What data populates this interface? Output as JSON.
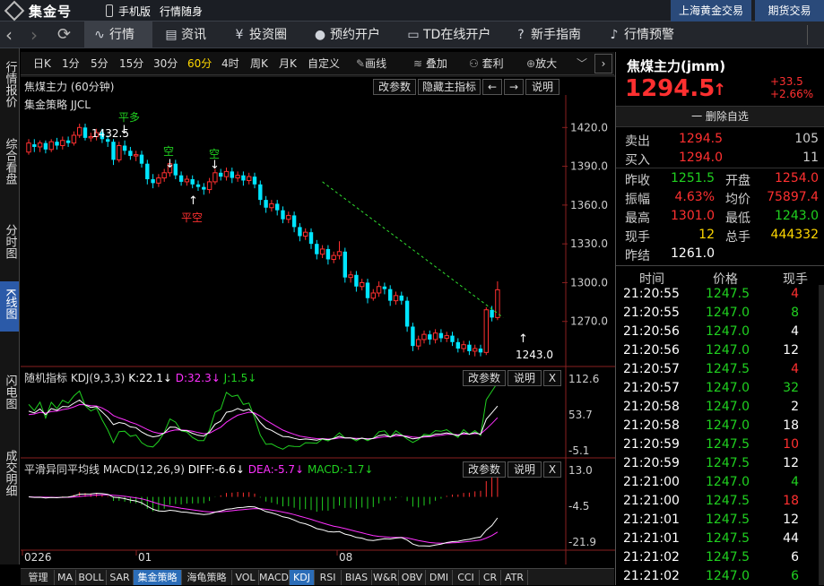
{
  "app": {
    "logo": "集金号",
    "mobile_label": "手机版",
    "mobile_sub": "行情随身",
    "top_links": [
      "上海黄金交易",
      "期货交易"
    ]
  },
  "nav": {
    "items": [
      {
        "label": "行情",
        "icon": "chart-line-icon"
      },
      {
        "label": "资讯",
        "icon": "news-icon"
      },
      {
        "label": "投资圈",
        "icon": "yen-icon"
      },
      {
        "label": "预约开户",
        "icon": "pin-icon"
      },
      {
        "label": "TD在线开户",
        "icon": "card-icon"
      },
      {
        "label": "新手指南",
        "icon": "question-icon"
      },
      {
        "label": "行情预警",
        "icon": "bell-icon"
      }
    ]
  },
  "side_tabs": [
    "行情报价",
    "综合看盘",
    "分时图",
    "K线图",
    "闪电图",
    "成交明细"
  ],
  "periods": [
    "日K",
    "1分",
    "5分",
    "15分",
    "30分",
    "60分",
    "4时",
    "周K",
    "月K",
    "自定义"
  ],
  "tools": [
    "画线",
    "叠加",
    "套利",
    "放大"
  ],
  "main_panel": {
    "title": "焦煤主力 (60分钟)",
    "strategy": "集金策略 JJCL",
    "btn_modify": "改参数",
    "btn_hide": "隐藏主指标",
    "btn_help": "说明",
    "arrow_left": "←",
    "arrow_right": "→"
  },
  "kdj_panel": {
    "title": "随机指标 KDJ(9,3,3)",
    "k": "K:22.1↓",
    "d": "D:32.3↓",
    "j": "J:1.5↓",
    "btn_modify": "改参数",
    "btn_help": "说明",
    "btn_close": "X",
    "ticks": [
      "112.6",
      "53.7",
      "-5.1"
    ]
  },
  "macd_panel": {
    "title": "平滑异同平均线 MACD(12,26,9)",
    "diff": "DIFF:-6.6↓",
    "dea": "DEA:-5.7↓",
    "macd": "MACD:-1.7↓",
    "btn_modify": "改参数",
    "btn_help": "说明",
    "btn_close": "X",
    "ticks": [
      "13.0",
      "-4.5",
      "-21.9"
    ]
  },
  "x_labels": [
    "0226",
    "01",
    "08"
  ],
  "chart_data": {
    "type": "candlestick",
    "y_range": [
      1240,
      1432
    ],
    "y_ticks": [
      1420,
      1390,
      1360,
      1330,
      1300,
      1270
    ],
    "candles": [
      [
        1401,
        1408,
        1399,
        1411
      ],
      [
        1407,
        1405,
        1401,
        1411
      ],
      [
        1405,
        1408,
        1401,
        1410
      ],
      [
        1408,
        1403,
        1400,
        1410
      ],
      [
        1403,
        1409,
        1401,
        1411
      ],
      [
        1409,
        1406,
        1403,
        1412
      ],
      [
        1406,
        1410,
        1403,
        1413
      ],
      [
        1410,
        1408,
        1405,
        1413
      ],
      [
        1408,
        1414,
        1406,
        1417
      ],
      [
        1414,
        1420,
        1412,
        1423
      ],
      [
        1420,
        1412,
        1410,
        1423
      ],
      [
        1412,
        1413,
        1409,
        1416
      ],
      [
        1413,
        1416,
        1410,
        1419
      ],
      [
        1416,
        1411,
        1408,
        1419
      ],
      [
        1411,
        1409,
        1405,
        1414
      ],
      [
        1409,
        1395,
        1391,
        1411
      ],
      [
        1395,
        1406,
        1393,
        1409
      ],
      [
        1406,
        1402,
        1399,
        1410
      ],
      [
        1402,
        1398,
        1395,
        1405
      ],
      [
        1398,
        1399,
        1394,
        1402
      ],
      [
        1399,
        1392,
        1389,
        1402
      ],
      [
        1392,
        1380,
        1376,
        1395
      ],
      [
        1380,
        1377,
        1373,
        1384
      ],
      [
        1377,
        1381,
        1374,
        1384
      ],
      [
        1381,
        1385,
        1378,
        1388
      ],
      [
        1385,
        1392,
        1382,
        1395
      ],
      [
        1392,
        1383,
        1380,
        1395
      ],
      [
        1383,
        1378,
        1375,
        1386
      ],
      [
        1378,
        1380,
        1375,
        1383
      ],
      [
        1380,
        1376,
        1373,
        1383
      ],
      [
        1376,
        1374,
        1371,
        1379
      ],
      [
        1374,
        1372,
        1368,
        1377
      ],
      [
        1372,
        1378,
        1369,
        1381
      ],
      [
        1378,
        1385,
        1376,
        1388
      ],
      [
        1385,
        1382,
        1379,
        1388
      ],
      [
        1382,
        1386,
        1379,
        1389
      ],
      [
        1386,
        1381,
        1377,
        1389
      ],
      [
        1381,
        1383,
        1378,
        1386
      ],
      [
        1383,
        1379,
        1375,
        1386
      ],
      [
        1379,
        1382,
        1376,
        1385
      ],
      [
        1382,
        1376,
        1373,
        1385
      ],
      [
        1376,
        1364,
        1360,
        1379
      ],
      [
        1364,
        1358,
        1354,
        1367
      ],
      [
        1358,
        1361,
        1355,
        1364
      ],
      [
        1361,
        1356,
        1352,
        1364
      ],
      [
        1356,
        1349,
        1346,
        1359
      ],
      [
        1349,
        1352,
        1346,
        1355
      ],
      [
        1352,
        1343,
        1339,
        1355
      ],
      [
        1343,
        1336,
        1332,
        1346
      ],
      [
        1336,
        1339,
        1333,
        1342
      ],
      [
        1339,
        1330,
        1326,
        1342
      ],
      [
        1330,
        1322,
        1318,
        1333
      ],
      [
        1322,
        1326,
        1319,
        1329
      ],
      [
        1326,
        1318,
        1314,
        1329
      ],
      [
        1318,
        1321,
        1315,
        1324
      ],
      [
        1321,
        1324,
        1318,
        1332
      ],
      [
        1324,
        1304,
        1300,
        1327
      ],
      [
        1304,
        1306,
        1300,
        1309
      ],
      [
        1306,
        1297,
        1293,
        1309
      ],
      [
        1297,
        1300,
        1294,
        1303
      ],
      [
        1300,
        1288,
        1284,
        1303
      ],
      [
        1288,
        1292,
        1286,
        1295
      ],
      [
        1292,
        1297,
        1289,
        1301
      ],
      [
        1297,
        1295,
        1291,
        1300
      ],
      [
        1295,
        1286,
        1282,
        1298
      ],
      [
        1286,
        1290,
        1283,
        1293
      ],
      [
        1290,
        1286,
        1283,
        1293
      ],
      [
        1286,
        1266,
        1262,
        1289
      ],
      [
        1266,
        1251,
        1247,
        1269
      ],
      [
        1251,
        1256,
        1248,
        1259
      ],
      [
        1256,
        1260,
        1253,
        1263
      ],
      [
        1260,
        1256,
        1252,
        1263
      ],
      [
        1256,
        1261,
        1253,
        1264
      ],
      [
        1261,
        1257,
        1254,
        1264
      ],
      [
        1257,
        1259,
        1254,
        1262
      ],
      [
        1259,
        1254,
        1251,
        1262
      ],
      [
        1254,
        1249,
        1246,
        1257
      ],
      [
        1249,
        1252,
        1246,
        1255
      ],
      [
        1252,
        1247,
        1244,
        1255
      ],
      [
        1247,
        1249,
        1243,
        1252
      ],
      [
        1249,
        1246,
        1243,
        1252
      ],
      [
        1246,
        1279,
        1244,
        1281
      ],
      [
        1279,
        1273,
        1270,
        1282
      ],
      [
        1273,
        1294.5,
        1271,
        1301
      ]
    ],
    "annotations": [
      {
        "text": "平多",
        "color": "green"
      },
      {
        "text": "空",
        "color": "green"
      },
      {
        "text": "空",
        "color": "green"
      },
      {
        "text": "平空",
        "color": "red"
      },
      {
        "text": "1432.5",
        "color": "white"
      },
      {
        "text": "1243.0",
        "color": "white"
      }
    ],
    "trendline": [
      [
        52,
        1378
      ],
      [
        84,
        1273
      ]
    ]
  },
  "quote": {
    "name": "焦煤主力(jmm)",
    "price": "1294.5",
    "up_arrow": "↑",
    "change": "+33.5",
    "change_pct": "+2.66%",
    "remove_btn": "删除自选",
    "minus_sym": "一",
    "sell_label": "卖出",
    "sell_price": "1294.5",
    "sell_vol": "105",
    "buy_label": "买入",
    "buy_price": "1294.0",
    "buy_vol": "11",
    "stats": [
      {
        "l1": "昨收",
        "v1": "1251.5",
        "c1": "green",
        "l2": "开盘",
        "v2": "1254.0",
        "c2": "red"
      },
      {
        "l1": "振幅",
        "v1": "4.63%",
        "c1": "red",
        "l2": "均价",
        "v2": "75897.4",
        "c2": "red"
      },
      {
        "l1": "最高",
        "v1": "1301.0",
        "c1": "red",
        "l2": "最低",
        "v2": "1243.0",
        "c2": "green"
      },
      {
        "l1": "现手",
        "v1": "12",
        "c1": "yellow",
        "l2": "总手",
        "v2": "444332",
        "c2": "yellow"
      },
      {
        "l1": "昨结",
        "v1": "1261.0",
        "c1": "white",
        "l2": "",
        "v2": "",
        "c2": "white"
      }
    ]
  },
  "trades": {
    "headers": [
      "时间",
      "价格",
      "现手"
    ],
    "rows": [
      [
        "21:20:55",
        "1247.5",
        "4",
        "red"
      ],
      [
        "21:20:55",
        "1247.0",
        "8",
        "green"
      ],
      [
        "21:20:56",
        "1247.0",
        "4",
        "white"
      ],
      [
        "21:20:56",
        "1247.0",
        "12",
        "white"
      ],
      [
        "21:20:57",
        "1247.5",
        "4",
        "red"
      ],
      [
        "21:20:57",
        "1247.0",
        "32",
        "green"
      ],
      [
        "21:20:58",
        "1247.0",
        "2",
        "white"
      ],
      [
        "21:20:58",
        "1247.0",
        "18",
        "white"
      ],
      [
        "21:20:59",
        "1247.5",
        "10",
        "red"
      ],
      [
        "21:20:59",
        "1247.5",
        "12",
        "white"
      ],
      [
        "21:21:00",
        "1247.0",
        "4",
        "green"
      ],
      [
        "21:21:00",
        "1247.5",
        "18",
        "red"
      ],
      [
        "21:21:01",
        "1247.5",
        "12",
        "white"
      ],
      [
        "21:21:01",
        "1247.5",
        "44",
        "white"
      ],
      [
        "21:21:02",
        "1247.5",
        "6",
        "white"
      ],
      [
        "21:21:02",
        "1247.0",
        "6",
        "green"
      ]
    ]
  },
  "bottom_tabs": [
    "管理",
    "MA",
    "BOLL",
    "SAR",
    "集金策略",
    "海龟策略",
    "VOL",
    "MACD",
    "KDJ",
    "RSI",
    "BIAS",
    "W&R",
    "OBV",
    "DMI",
    "CCI",
    "CR",
    "ATR"
  ],
  "colors": {
    "up": "#ff3030",
    "down": "#00e5ff",
    "green": "#20d020",
    "magenta": "#ff30ff",
    "yellow": "#ffd800"
  }
}
